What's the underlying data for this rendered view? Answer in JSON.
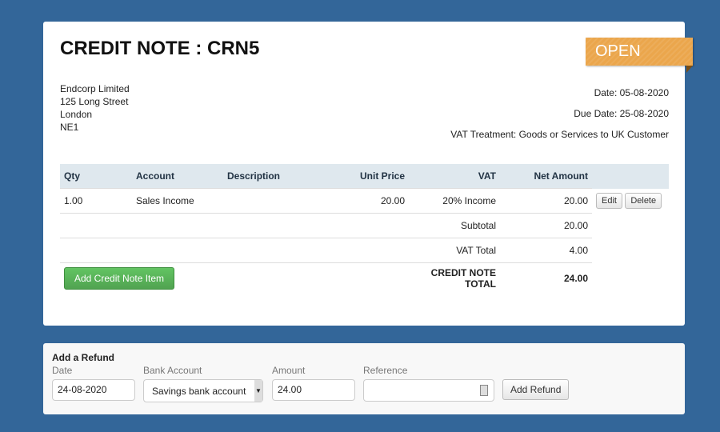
{
  "title": "CREDIT NOTE : CRN5",
  "status": "OPEN",
  "status_color": "#eba64c",
  "address": [
    "Endcorp Limited",
    "125 Long Street",
    "London",
    "NE1"
  ],
  "meta": {
    "date": "Date: 05-08-2020",
    "due": "Due Date: 25-08-2020",
    "vat": "VAT Treatment: Goods or Services to UK Customer"
  },
  "table": {
    "headers": [
      "Qty",
      "Account",
      "Description",
      "Unit Price",
      "VAT",
      "Net Amount"
    ],
    "rows": [
      {
        "qty": "1.00",
        "account": "Sales Income",
        "description": "",
        "unit_price": "20.00",
        "vat": "20% Income",
        "net": "20.00",
        "edit": "Edit",
        "delete": "Delete"
      }
    ],
    "subtotal_label": "Subtotal",
    "subtotal": "20.00",
    "vat_total_label": "VAT Total",
    "vat_total": "4.00",
    "total_label": "CREDIT NOTE TOTAL",
    "total": "24.00",
    "add_item": "Add Credit Note Item"
  },
  "refund": {
    "title": "Add a Refund",
    "date_label": "Date",
    "date": "24-08-2020",
    "bank_label": "Bank Account",
    "bank": "Savings bank account",
    "amount_label": "Amount",
    "amount": "24.00",
    "reference_label": "Reference",
    "reference": "",
    "button": "Add Refund"
  }
}
